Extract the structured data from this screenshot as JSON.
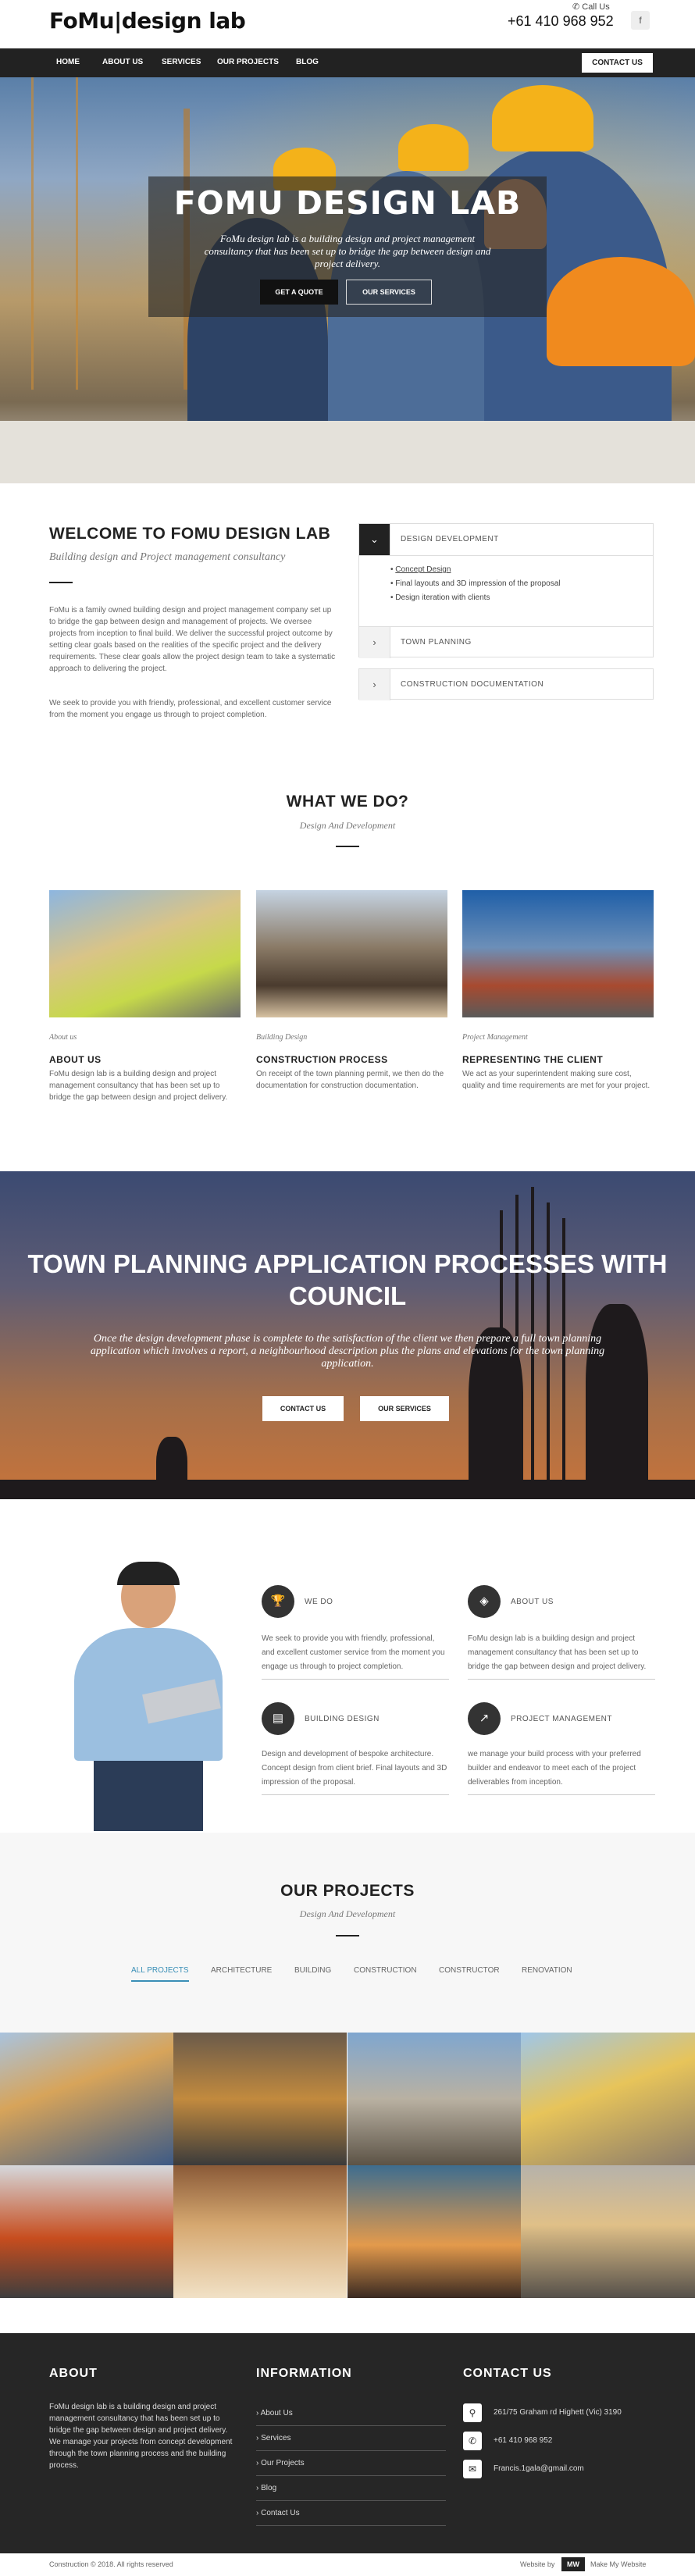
{
  "header": {
    "logo_text": "FoMu|design lab",
    "call_label": "Call Us",
    "phone": "+61 410 968 952",
    "facebook_icon": "f"
  },
  "nav": {
    "items": [
      "HOME",
      "ABOUT US",
      "SERVICES",
      "OUR PROJECTS",
      "BLOG"
    ],
    "contact_button": "CONTACT US"
  },
  "hero": {
    "title": "FOMU DESIGN LAB",
    "subtitle": "FoMu design lab is a building design and project management consultancy that has been set up to bridge the gap between design and project delivery.",
    "primary_button": "GET A QUOTE",
    "secondary_button": "OUR SERVICES"
  },
  "welcome": {
    "title": "WELCOME TO FOMU DESIGN LAB",
    "subtitle": "Building design and Project management consultancy",
    "paragraph1": "FoMu is a family owned building design and project management company set up to bridge the gap between design and management of projects. We oversee projects from inception to final build. We deliver the successful project outcome by setting clear goals based on the realities of the specific project and the delivery requirements. These clear goals allow the project design team to take a systematic approach to delivering the project.",
    "paragraph2": "We seek to provide you with friendly, professional, and excellent customer service from the moment you engage us through to project completion."
  },
  "accordion": {
    "panels": [
      {
        "title": "DESIGN DEVELOPMENT",
        "icon": "chevron-down",
        "items": [
          "Concept Design",
          "Final layouts and 3D impression of the proposal",
          "Design iteration with clients"
        ]
      },
      {
        "title": "TOWN PLANNING",
        "icon": "chevron-right"
      },
      {
        "title": "CONSTRUCTION DOCUMENTATION",
        "icon": "chevron-right"
      }
    ]
  },
  "what_we_do": {
    "title": "WHAT WE DO?",
    "subtitle": "Design And Development",
    "cards": [
      {
        "category": "About us",
        "title": "ABOUT US",
        "text": "FoMu design lab is a building design and project management consultancy that has been set up to bridge the gap between design and project delivery."
      },
      {
        "category": "Building Design",
        "title": "CONSTRUCTION PROCESS",
        "text": "On receipt of the town planning permit, we then do the documentation for construction documentation."
      },
      {
        "category": "Project Management",
        "title": "REPRESENTING THE CLIENT",
        "text": "We act as your superintendent making sure cost, quality and time requirements are met for your project."
      }
    ]
  },
  "town_planning": {
    "title": "TOWN PLANNING APPLICATION PROCESSES WITH COUNCIL",
    "text": "Once the design development phase is complete to the satisfaction of the client we then prepare a full town planning application which involves a report, a neighbourhood description plus the plans and elevations for the town planning application.",
    "button1": "CONTACT US",
    "button2": "OUR SERVICES"
  },
  "features": [
    {
      "title": "WE DO",
      "icon": "trophy",
      "text": "We seek to provide you with friendly, professional, and excellent customer service from the moment you engage us through to project completion."
    },
    {
      "title": "ABOUT US",
      "icon": "layers",
      "text": "FoMu design lab is a building design and project management consultancy that has been set up to bridge the gap between design and project delivery."
    },
    {
      "title": "BUILDING DESIGN",
      "icon": "document",
      "text": "Design and development of bespoke architecture. Concept design from client brief. Final layouts and 3D impression of the proposal."
    },
    {
      "title": "PROJECT MANAGEMENT",
      "icon": "chart",
      "text": "we manage your build process with your preferred builder and endeavor to meet each of the project deliverables from inception."
    }
  ],
  "projects": {
    "title": "OUR PROJECTS",
    "subtitle": "Design And Development",
    "filters": [
      "ALL PROJECTS",
      "ARCHITECTURE",
      "BUILDING",
      "CONSTRUCTION",
      "CONSTRUCTOR",
      "RENOVATION"
    ]
  },
  "footer": {
    "about_title": "ABOUT",
    "about_text": "FoMu design lab is a building design and project management consultancy that has been set up to bridge the gap between design and project delivery. We manage your projects from concept development through the town planning process and the building process.",
    "info_title": "INFORMATION",
    "links": [
      "About Us",
      "Services",
      "Our Projects",
      "Blog",
      "Contact Us"
    ],
    "contact_title": "CONTACT US",
    "address": "261/75 Graham rd  Highett (Vic) 3190",
    "phone": "+61 410 968 952",
    "email": "Francis.1gala@gmail.com"
  },
  "copyright": {
    "text": "Construction © 2018. All rights reserved",
    "credit": "Website by",
    "credit_brand": "Make My Website"
  },
  "colors": {
    "dark": "#222222",
    "footer": "#262626",
    "accent_tab": "#3a8fb7",
    "helmet": "#f4b21a"
  }
}
